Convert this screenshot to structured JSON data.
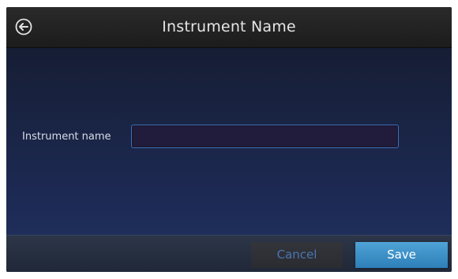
{
  "header": {
    "title": "Instrument Name",
    "back_icon": "back-arrow-circle-icon"
  },
  "form": {
    "instrument_name_label": "Instrument name",
    "instrument_name_value": "",
    "instrument_name_placeholder": ""
  },
  "footer": {
    "cancel_label": "Cancel",
    "save_label": "Save"
  },
  "colors": {
    "save_button": "#3b93ca",
    "cancel_text": "#4b74b6",
    "input_border": "#3d6fb5"
  }
}
